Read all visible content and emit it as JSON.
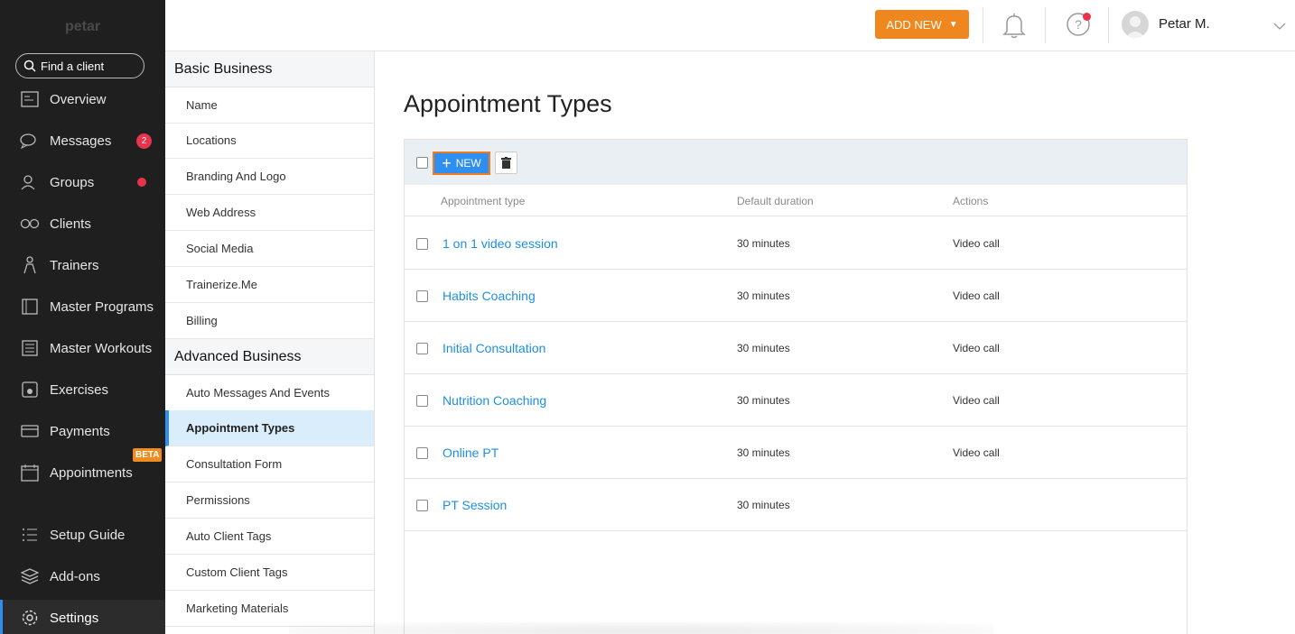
{
  "sidebar": {
    "brand": "petar",
    "search_label": "Find a client",
    "items": [
      {
        "label": "Overview",
        "icon": "overview-icon"
      },
      {
        "label": "Messages",
        "icon": "chat-icon",
        "badge": "2"
      },
      {
        "label": "Groups",
        "icon": "groups-icon"
      },
      {
        "label": "Clients",
        "icon": "clients-icon"
      },
      {
        "label": "Trainers",
        "icon": "trainers-icon"
      },
      {
        "label": "Master Programs",
        "icon": "book-icon"
      },
      {
        "label": "Master Workouts",
        "icon": "list-icon"
      },
      {
        "label": "Exercises",
        "icon": "kettlebell-icon"
      },
      {
        "label": "Payments",
        "icon": "card-icon"
      },
      {
        "label": "Appointments",
        "icon": "calendar-icon",
        "tag": "BETA"
      },
      {
        "label": "Setup Guide",
        "icon": "checklist-icon"
      },
      {
        "label": "Add-ons",
        "icon": "layers-icon"
      },
      {
        "label": "Settings",
        "icon": "gear-icon"
      }
    ]
  },
  "settings_menu": {
    "basic_heading": "Basic Business",
    "basic_items": [
      "Name",
      "Locations",
      "Branding And Logo",
      "Web Address",
      "Social Media",
      "Trainerize.Me",
      "Billing"
    ],
    "advanced_heading": "Advanced Business",
    "advanced_items": [
      "Auto Messages And Events",
      "Appointment Types",
      "Consultation Form",
      "Permissions",
      "Auto Client Tags",
      "Custom Client Tags",
      "Marketing Materials"
    ]
  },
  "topbar": {
    "add_new_label": "ADD NEW",
    "user_name": "Petar M."
  },
  "main": {
    "title": "Appointment Types",
    "new_button_label": "NEW",
    "columns": [
      "Appointment type",
      "Default duration",
      "Actions"
    ],
    "rows": [
      {
        "name": "1 on 1 video session",
        "duration": "30 minutes",
        "action": "Video call"
      },
      {
        "name": "Habits Coaching",
        "duration": "30 minutes",
        "action": "Video call"
      },
      {
        "name": "Initial Consultation",
        "duration": "30 minutes",
        "action": "Video call"
      },
      {
        "name": "Nutrition Coaching",
        "duration": "30 minutes",
        "action": "Video call"
      },
      {
        "name": "Online PT",
        "duration": "30 minutes",
        "action": "Video call"
      },
      {
        "name": "PT Session",
        "duration": "30 minutes",
        "action": ""
      }
    ]
  },
  "colors": {
    "accent_blue": "#2e8ff0",
    "accent_orange": "#f0861e",
    "badge_red": "#e8334a",
    "sidebar_bg": "#1f1f1f"
  }
}
